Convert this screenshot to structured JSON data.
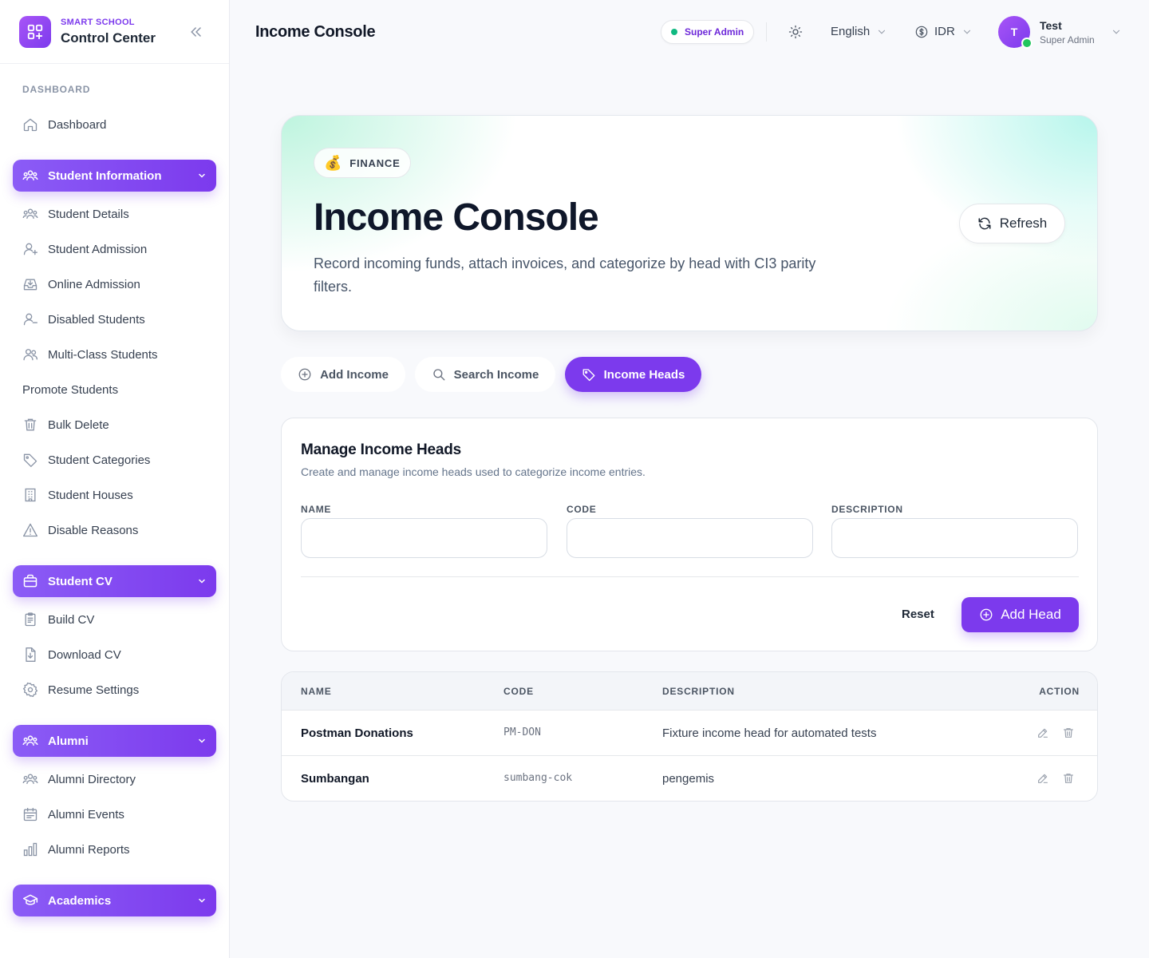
{
  "brand": {
    "subtitle": "SMART SCHOOL",
    "title": "Control Center"
  },
  "sidebar": {
    "section_label": "DASHBOARD",
    "dashboard": "Dashboard",
    "groups": [
      {
        "label": "Student Information",
        "icon": "users-icon",
        "items": [
          {
            "label": "Student Details",
            "icon": "users-icon"
          },
          {
            "label": "Student Admission",
            "icon": "user-plus-icon"
          },
          {
            "label": "Online Admission",
            "icon": "inbox-download-icon"
          },
          {
            "label": "Disabled Students",
            "icon": "user-minus-icon"
          },
          {
            "label": "Multi-Class Students",
            "icon": "users-pair-icon"
          },
          {
            "label": "Promote Students",
            "icon": ""
          },
          {
            "label": "Bulk Delete",
            "icon": "trash-icon"
          },
          {
            "label": "Student Categories",
            "icon": "tag-icon"
          },
          {
            "label": "Student Houses",
            "icon": "building-icon"
          },
          {
            "label": "Disable Reasons",
            "icon": "warning-icon"
          }
        ]
      },
      {
        "label": "Student CV",
        "icon": "briefcase-icon",
        "items": [
          {
            "label": "Build CV",
            "icon": "clipboard-icon"
          },
          {
            "label": "Download CV",
            "icon": "file-download-icon"
          },
          {
            "label": "Resume Settings",
            "icon": "gear-icon"
          }
        ]
      },
      {
        "label": "Alumni",
        "icon": "users-icon",
        "items": [
          {
            "label": "Alumni Directory",
            "icon": "users-icon"
          },
          {
            "label": "Alumni Events",
            "icon": "calendar-icon"
          },
          {
            "label": "Alumni Reports",
            "icon": "bar-chart-icon"
          }
        ]
      },
      {
        "label": "Academics",
        "icon": "graduation-cap-icon",
        "items": []
      }
    ]
  },
  "topbar": {
    "page_title": "Income Console",
    "role_badge": "Super Admin",
    "language": "English",
    "currency": "IDR",
    "user": {
      "initial": "T",
      "name": "Test",
      "role": "Super Admin"
    }
  },
  "hero": {
    "badge_emoji": "💰",
    "badge": "FINANCE",
    "title": "Income Console",
    "description": "Record incoming funds, attach invoices, and categorize by head with CI3 parity filters.",
    "refresh_label": "Refresh"
  },
  "tabs": [
    {
      "label": "Add Income",
      "icon": "plus-circle-icon",
      "active": false
    },
    {
      "label": "Search Income",
      "icon": "search-icon",
      "active": false
    },
    {
      "label": "Income Heads",
      "icon": "tag-icon",
      "active": true
    }
  ],
  "form": {
    "title": "Manage Income Heads",
    "subtitle": "Create and manage income heads used to categorize income entries.",
    "fields": {
      "name_label": "NAME",
      "code_label": "CODE",
      "description_label": "DESCRIPTION",
      "name_value": "",
      "code_value": "",
      "description_value": ""
    },
    "reset_label": "Reset",
    "submit_label": "Add Head"
  },
  "table": {
    "columns": [
      "NAME",
      "CODE",
      "DESCRIPTION",
      "ACTION"
    ],
    "rows": [
      {
        "name": "Postman Donations",
        "code": "PM-DON",
        "description": "Fixture income head for automated tests"
      },
      {
        "name": "Sumbangan",
        "code": "sumbang-cok",
        "description": "pengemis"
      }
    ]
  },
  "colors": {
    "accent": "#7c3aed",
    "online": "#22c55e",
    "status_dot": "#10b981"
  }
}
